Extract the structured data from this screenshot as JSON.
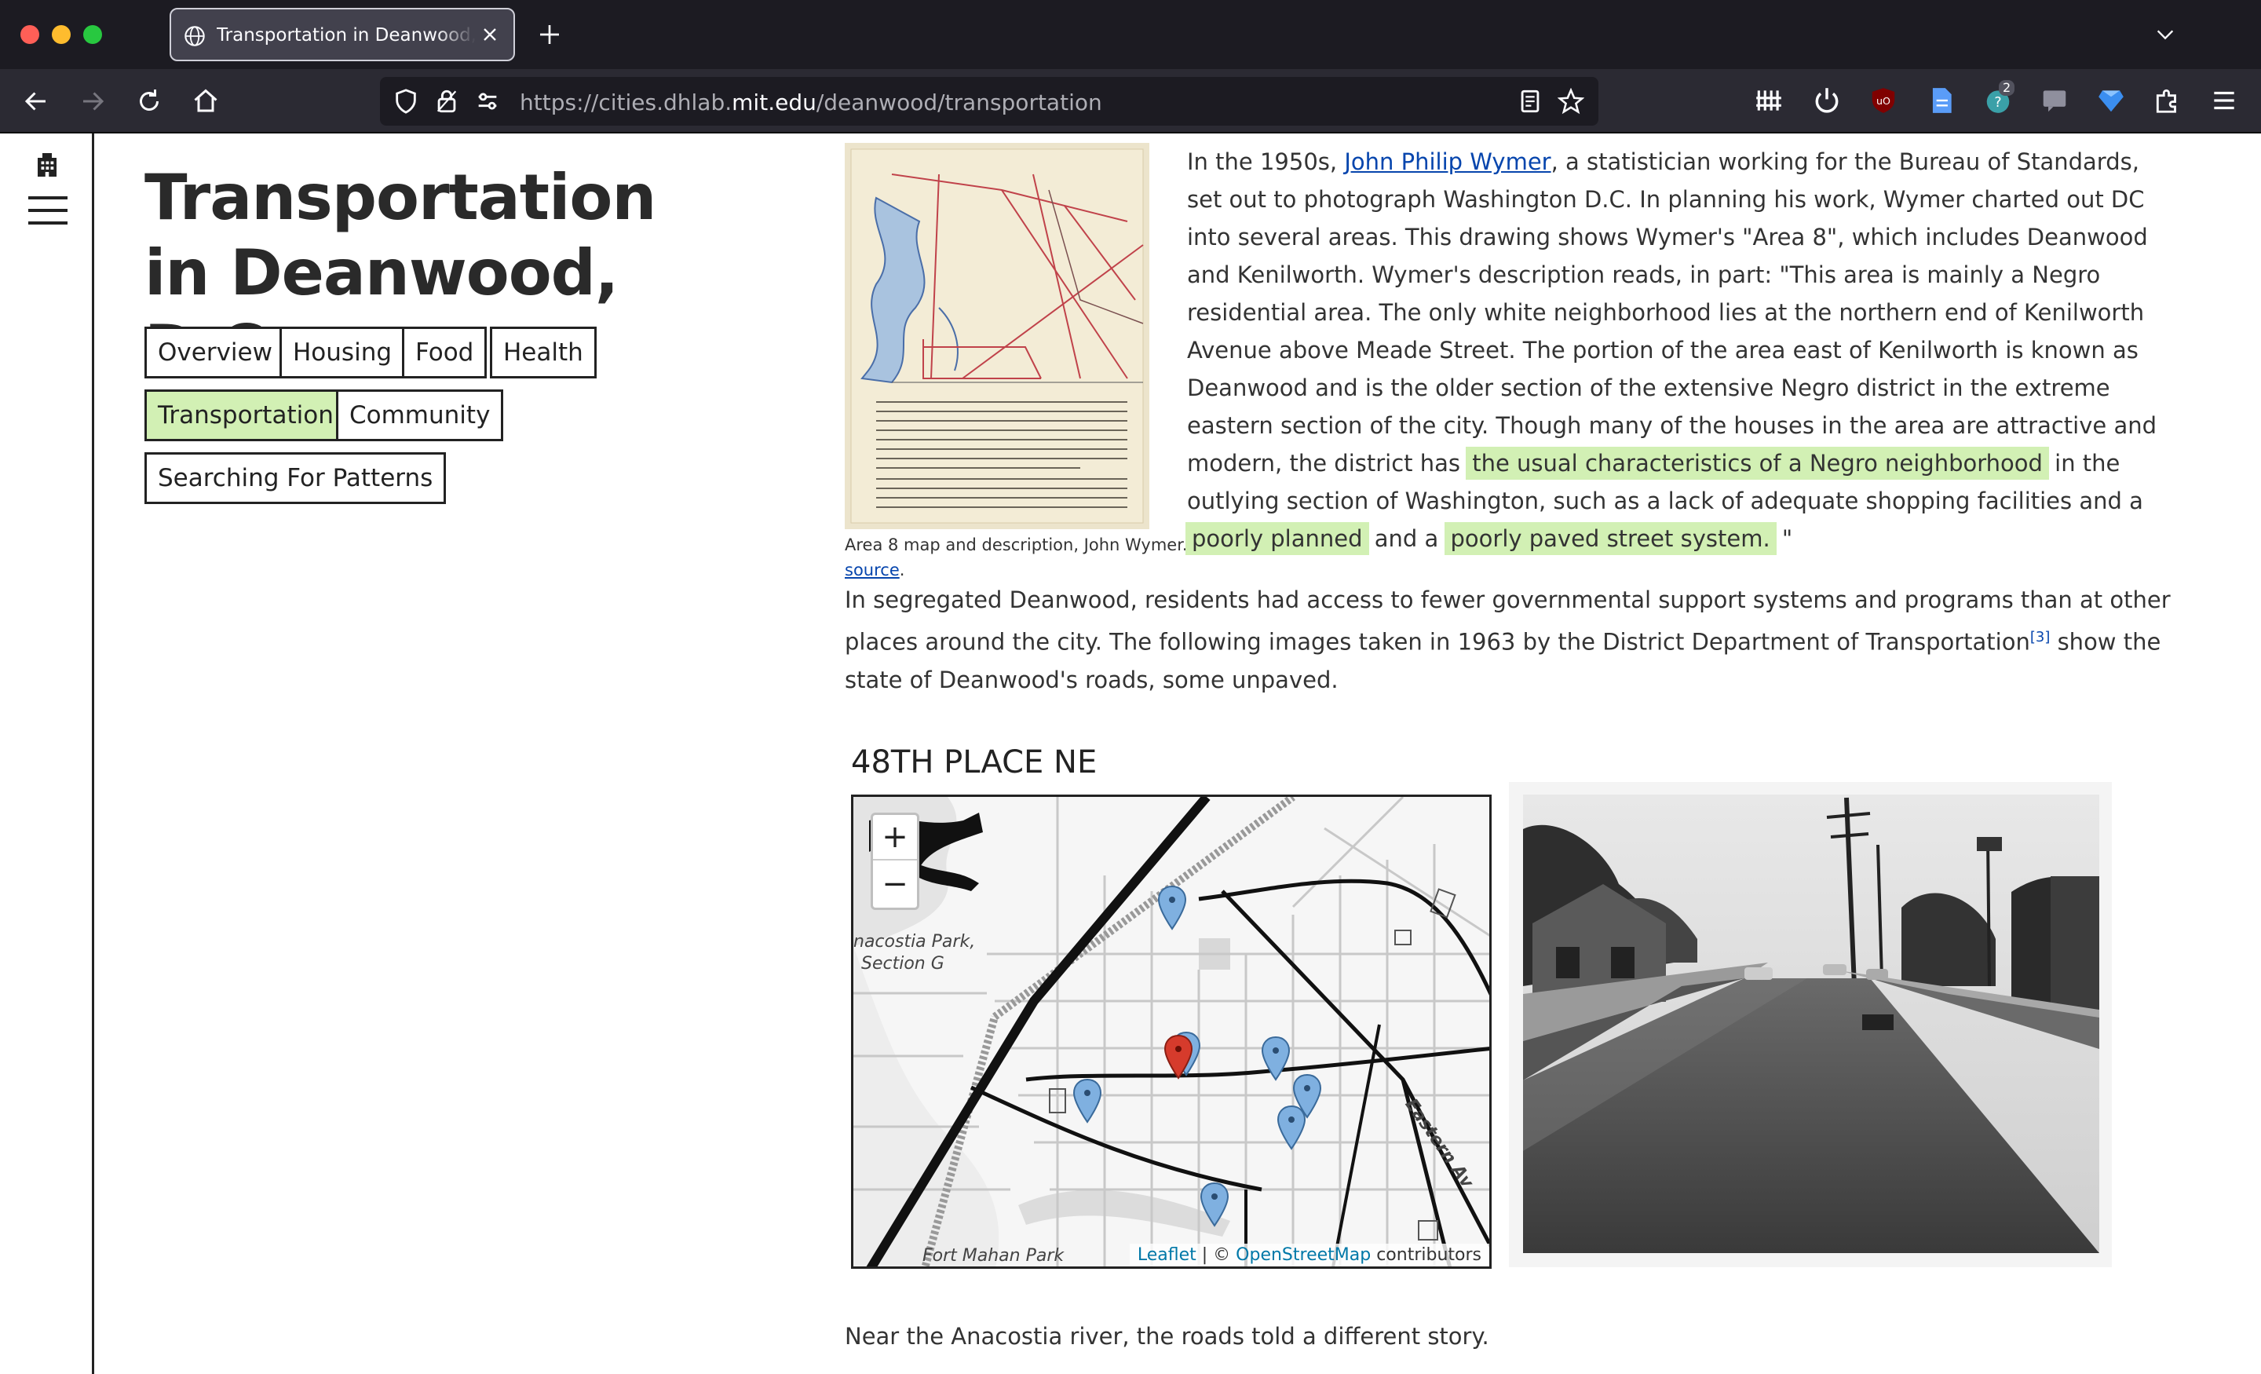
{
  "browser": {
    "tab_title": "Transportation in Deanwood, D.C.",
    "url_prefix": "https://cities.dhlab.",
    "url_host": "mit.edu",
    "url_path": "/deanwood/transportation",
    "extension_badge": "2"
  },
  "page": {
    "title": "Transportation in Deanwood, D.C.",
    "subnav": {
      "overview": "Overview",
      "housing": "Housing",
      "food": "Food",
      "health": "Health",
      "transportation": "Transportation",
      "community": "Community",
      "patterns": "Searching For Patterns"
    },
    "figure": {
      "caption": "Area 8 map and description, John Wymer.",
      "source_link": "source",
      "source_suffix": "."
    },
    "para1": {
      "before_link": "In the 1950s, ",
      "link": "John Philip Wymer",
      "text1": ", a statistician working for the Bureau of Standards, set out to photograph Washington D.C. In planning his work, Wymer charted out DC into several areas. This drawing shows Wymer's \"Area 8\", which includes Deanwood and Kenilworth. Wymer's description reads, in part: \"This area is mainly a Negro residential area. The only white neighborhood lies at the northern end of Kenilworth Avenue above Meade Street. The portion of the area east of Kenilworth is known as Deanwood and is the older section of the extensive Negro district in the extreme eastern section of the city. Though many of the houses in the area are attractive and modern, the district has ",
      "hl1": "the usual characteristics of a Negro neighborhood",
      "text2": " in the outlying section of Washington, such as a lack of adequate shopping facilities and a ",
      "hl2": "poorly planned",
      "text3": " and a ",
      "hl3": "poorly paved street system.",
      "text4": " \""
    },
    "para2": {
      "text1": "In segregated Deanwood, residents had access to fewer governmental support systems and programs than at other places around the city. The following images taken in 1963 by the District Department of Transportation",
      "ref": "[3]",
      "text2": "  show the state of Deanwood's roads, some unpaved."
    },
    "section_heading": "48TH PLACE NE",
    "map": {
      "zoom_in": "+",
      "zoom_out": "−",
      "attribution_leaflet": "Leaflet",
      "attribution_sep": " | © ",
      "attribution_osm": "OpenStreetMap",
      "attribution_suffix": " contributors",
      "label_park1": "nacostia Park,",
      "label_park2": "Section G",
      "label_avenue": "Eastern Av",
      "label_fort": "Fort Mahan Park"
    },
    "para3": "Near the Anacostia river, the roads told a different story."
  },
  "colors": {
    "active_tab": "#d2f0b4",
    "highlight": "#d2f0b4",
    "link": "#0645ad",
    "marker_blue": "#7fb0e0",
    "marker_red": "#d63b2c"
  },
  "icons": [
    "globe-icon",
    "close-icon",
    "plus-icon",
    "chevron-down-icon",
    "back-arrow-icon",
    "forward-arrow-icon",
    "reload-icon",
    "home-icon",
    "shield-icon",
    "lock-icon",
    "permissions-icon",
    "reader-view-icon",
    "star-icon",
    "library-icon",
    "power-icon",
    "ublock-icon",
    "document-icon",
    "extension-badge-icon",
    "comment-icon",
    "gem-icon",
    "puzzle-icon",
    "menu-icon",
    "building-icon",
    "hamburger-icon",
    "map-marker-icon"
  ]
}
